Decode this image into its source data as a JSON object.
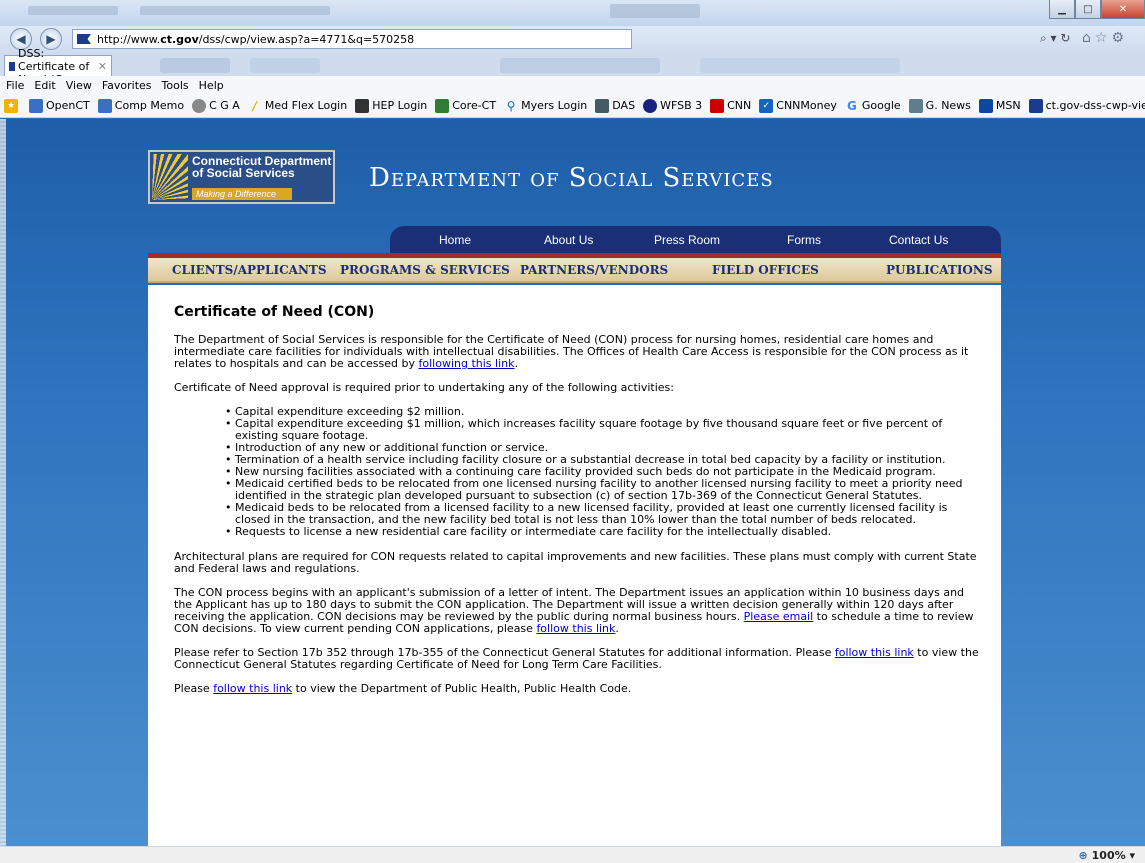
{
  "browser": {
    "url_prefix": "http://www.",
    "url_domain": "ct.gov",
    "url_rest": "/dss/cwp/view.asp?a=4771&q=570258",
    "tab_title": "DSS: Certificate of Need (C...",
    "zoom": "100%"
  },
  "menu": [
    "File",
    "Edit",
    "View",
    "Favorites",
    "Tools",
    "Help"
  ],
  "favorites": [
    {
      "label": "OpenCT",
      "color": "#3a6fc4"
    },
    {
      "label": "Comp Memo",
      "color": "#3a6fc4"
    },
    {
      "label": "C G A",
      "color": "#888888"
    },
    {
      "label": "Med Flex Login",
      "color": "#e6b800"
    },
    {
      "label": "HEP Login",
      "color": "#333333"
    },
    {
      "label": "Core-CT",
      "color": "#2e7d32"
    },
    {
      "label": "Myers Login",
      "color": "#1565c0"
    },
    {
      "label": "DAS",
      "color": "#455a64"
    },
    {
      "label": "WFSB 3",
      "color": "#1a237e"
    },
    {
      "label": "CNN",
      "color": "#cc0000"
    },
    {
      "label": "CNNMoney",
      "color": "#1565c0"
    },
    {
      "label": "Google",
      "color": "#4285f4"
    },
    {
      "label": "G. News",
      "color": "#607d8b"
    },
    {
      "label": "MSN",
      "color": "#0d47a1"
    },
    {
      "label": "ct.gov-dss-cwp-view.aspa...",
      "color": "#1b3b8f"
    }
  ],
  "site": {
    "logo_line1": "Connecticut Department",
    "logo_line2": "of Social Services",
    "logo_tagline": "Making a Difference",
    "title": "Department of Social Services",
    "topnav": [
      "Home",
      "About Us",
      "Press Room",
      "Forms",
      "Contact Us"
    ],
    "subnav": [
      "CLIENTS/APPLICANTS",
      "PROGRAMS & SERVICES",
      "PARTNERS/VENDORS",
      "FIELD OFFICES",
      "PUBLICATIONS"
    ]
  },
  "content": {
    "heading": "Certificate of Need (CON)",
    "p1_text": "The Department of Social Services is responsible for the Certificate of Need (CON) process for nursing homes, residential care homes and intermediate care facilities for individuals with intellectual disabilities. The Offices of Health Care Access is responsible for the CON process as it relates to hospitals and can be accessed by ",
    "p1_link": "following this link",
    "p1_end": ".",
    "p2": "Certificate of Need approval is required prior to undertaking any of the following activities:",
    "bullets": [
      "Capital expenditure exceeding $2 million.",
      "Capital expenditure exceeding $1 million, which increases facility square footage by five thousand square feet or five percent of existing square footage.",
      "Introduction of any new or additional function or service.",
      "Termination of a health service including facility closure or a substantial decrease in total bed capacity by a facility or institution.",
      "New nursing facilities associated with a continuing care facility provided such beds do not participate in the Medicaid program.",
      "Medicaid certified beds to be relocated from one licensed nursing facility to another licensed nursing facility to meet a priority need identified in the strategic plan developed pursuant to subsection (c) of section 17b-369 of the Connecticut General Statutes.",
      "Medicaid beds to be relocated from a licensed facility to a new licensed facility, provided at least one currently licensed facility is closed in the transaction, and the new facility bed total is not less than 10% lower than the total number of beds relocated.",
      "Requests to license a new residential care facility or intermediate care facility for the intellectually disabled."
    ],
    "p3": "Architectural plans are required for CON requests related to capital improvements and new facilities. These plans must comply with current State and Federal laws and regulations.",
    "p4_text": "The CON process begins with an applicant's submission of a letter of intent. The Department issues an application within 10 business days and the Applicant has up to 180 days to submit the CON application. The Department will issue a written decision generally within 120 days after receiving the application. CON decisions may be reviewed by the public during normal business hours. ",
    "p4_link1": "Please email",
    "p4_mid": " to schedule a time to review CON decisions. To view current pending CON applications, please ",
    "p4_link2": "follow this link",
    "p4_end": ".",
    "p5_text": "Please refer to Section 17b 352 through 17b-355 of the Connecticut General Statutes for additional information. Please ",
    "p5_link": "follow this link",
    "p5_end": " to view the Connecticut General Statutes regarding Certificate of Need for Long Term Care Facilities.",
    "p6_start": "Please ",
    "p6_link": "follow this link",
    "p6_end": " to view the Department of Public Health, Public Health Code."
  }
}
